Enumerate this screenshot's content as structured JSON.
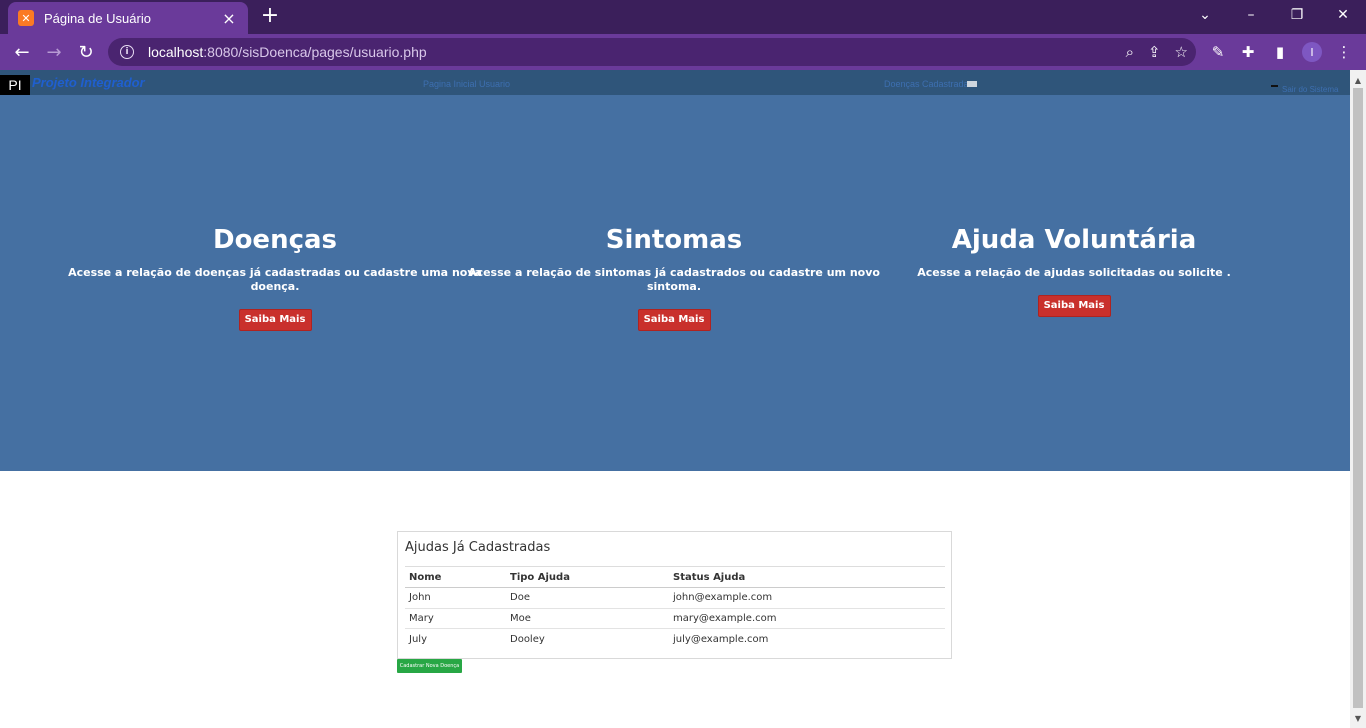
{
  "browser": {
    "tab_title": "Página de Usuário",
    "url_host": "localhost",
    "url_rest": ":8080/sisDoenca/pages/usuario.php",
    "profile_initial": "I",
    "colors": {
      "tabbar": "#3b1f5b",
      "toolbar": "#6a3a9a"
    }
  },
  "site_nav": {
    "logo": "PI",
    "brand": "Projeto Integrador",
    "link_center": "Pagina Inicial Usuario",
    "link_right": "Doenças Cadastradas",
    "link_far_right": "Sair do Sistema"
  },
  "hero": {
    "background": "#4570a2",
    "features": [
      {
        "title": "Doenças",
        "text": "Acesse a relação de doenças já cadastradas ou cadastre uma nova doença.",
        "button": "Saiba Mais"
      },
      {
        "title": "Sintomas",
        "text": "Acesse a relação de sintomas já cadastrados ou cadastre um novo sintoma.",
        "button": "Saiba Mais"
      },
      {
        "title": "Ajuda Voluntária",
        "text": "Acesse a relação de ajudas solicitadas ou solicite .",
        "button": "Saiba Mais"
      }
    ]
  },
  "ajudas": {
    "title": "Ajudas Já Cadastradas",
    "columns": [
      "Nome",
      "Tipo Ajuda",
      "Status Ajuda"
    ],
    "rows": [
      [
        "John",
        "Doe",
        "john@example.com"
      ],
      [
        "Mary",
        "Moe",
        "mary@example.com"
      ],
      [
        "July",
        "Dooley",
        "july@example.com"
      ]
    ],
    "add_button": "Cadastrar Nova Doença"
  }
}
